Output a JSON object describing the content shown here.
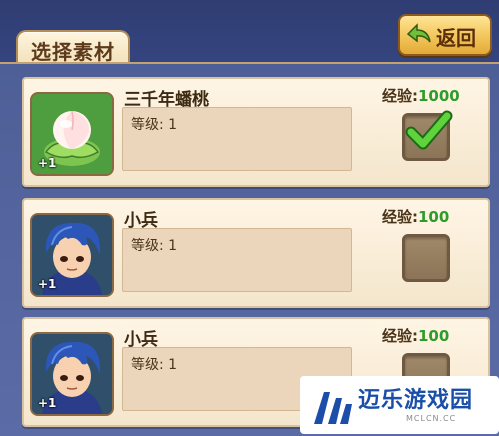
{
  "header": {
    "title": "选择素材",
    "back_label": "返回"
  },
  "items": [
    {
      "name": "三千年蟠桃",
      "exp_label": "经验:",
      "exp_value": "1000",
      "level_label": "等级: 1",
      "badge": "+1",
      "icon": "peach-icon",
      "selected": true
    },
    {
      "name": "小兵",
      "exp_label": "经验:",
      "exp_value": "100",
      "level_label": "等级: 1",
      "badge": "+1",
      "icon": "soldier-portrait",
      "selected": false
    },
    {
      "name": "小兵",
      "exp_label": "经验:",
      "exp_value": "100",
      "level_label": "等级: 1",
      "badge": "+1",
      "icon": "soldier-portrait",
      "selected": false
    }
  ],
  "watermark": {
    "brand": "迈乐游戏园",
    "domain": "MCLCN.CC"
  },
  "colors": {
    "accent_green": "#2d9c2a",
    "card_bg": "#fff5e5",
    "frame_bg": "#4e5f98"
  }
}
